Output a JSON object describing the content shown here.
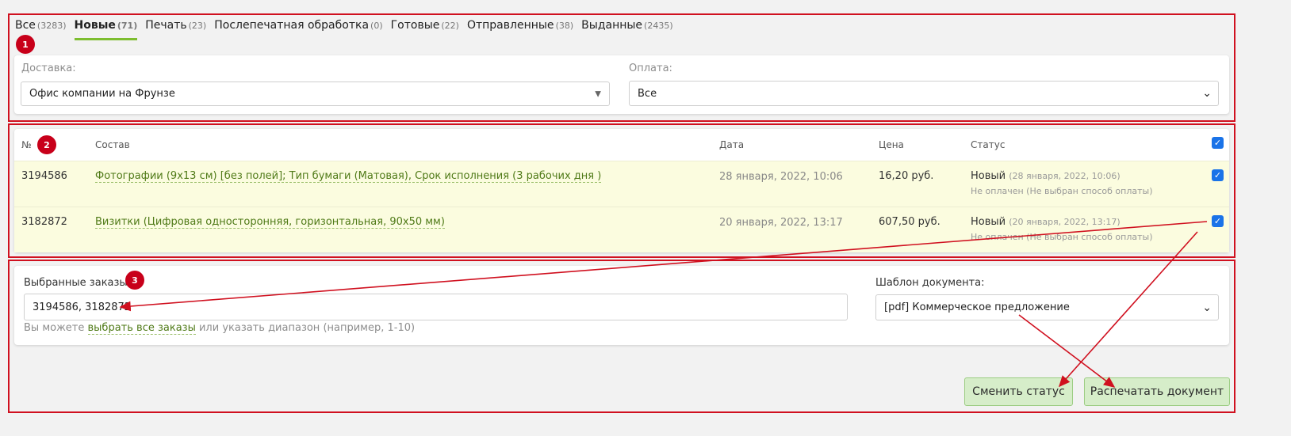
{
  "tabs": [
    {
      "label": "Все",
      "count": "(3283)",
      "active": false
    },
    {
      "label": "Новые",
      "count": "(71)",
      "active": true
    },
    {
      "label": "Печать",
      "count": "(23)",
      "active": false
    },
    {
      "label": "Послепечатная обработка",
      "count": "(0)",
      "active": false
    },
    {
      "label": "Готовые",
      "count": "(22)",
      "active": false
    },
    {
      "label": "Отправленные",
      "count": "(38)",
      "active": false
    },
    {
      "label": "Выданные",
      "count": "(2435)",
      "active": false
    }
  ],
  "badges": {
    "one": "1",
    "two": "2",
    "three": "3"
  },
  "filters": {
    "delivery_label": "Доставка:",
    "delivery_value": "Офис компании на Фрунзе",
    "payment_label": "Оплата:",
    "payment_value": "Все"
  },
  "table": {
    "headers": {
      "num": "№",
      "content": "Состав",
      "date": "Дата",
      "price": "Цена",
      "status": "Статус"
    },
    "rows": [
      {
        "num": "3194586",
        "content": "Фотографии (9x13 см) [без полей]; Тип бумаги (Матовая), Срок исполнения (3 рабочих дня )",
        "date": "28 января, 2022, 10:06",
        "price": "16,20 руб.",
        "status": "Новый",
        "status_date": "(28 января, 2022, 10:06)",
        "payment": "Не оплачен (Не выбран способ оплаты)"
      },
      {
        "num": "3182872",
        "content": "Визитки (Цифровая односторонняя, горизонтальная, 90x50 мм)",
        "date": "20 января, 2022, 13:17",
        "price": "607,50 руб.",
        "status": "Новый",
        "status_date": "(20 января, 2022, 13:17)",
        "payment": "Не оплачен (Не выбран способ оплаты)"
      }
    ]
  },
  "selection": {
    "label": "Выбранные заказы:",
    "value": "3194586, 3182872",
    "hint_before": "Вы можете ",
    "hint_link": "выбрать все заказы",
    "hint_after": " или указать диапазон (например, 1-10)",
    "template_label": "Шаблон документа:",
    "template_value": "[pdf] Коммерческое предложение"
  },
  "actions": {
    "change_status": "Сменить статус",
    "print_document": "Распечатать документ"
  },
  "colors": {
    "annotation": "#d0101f",
    "accent": "#7dbd2f",
    "checkbox": "#1a73e8",
    "row_bg": "#fbfcdf"
  }
}
